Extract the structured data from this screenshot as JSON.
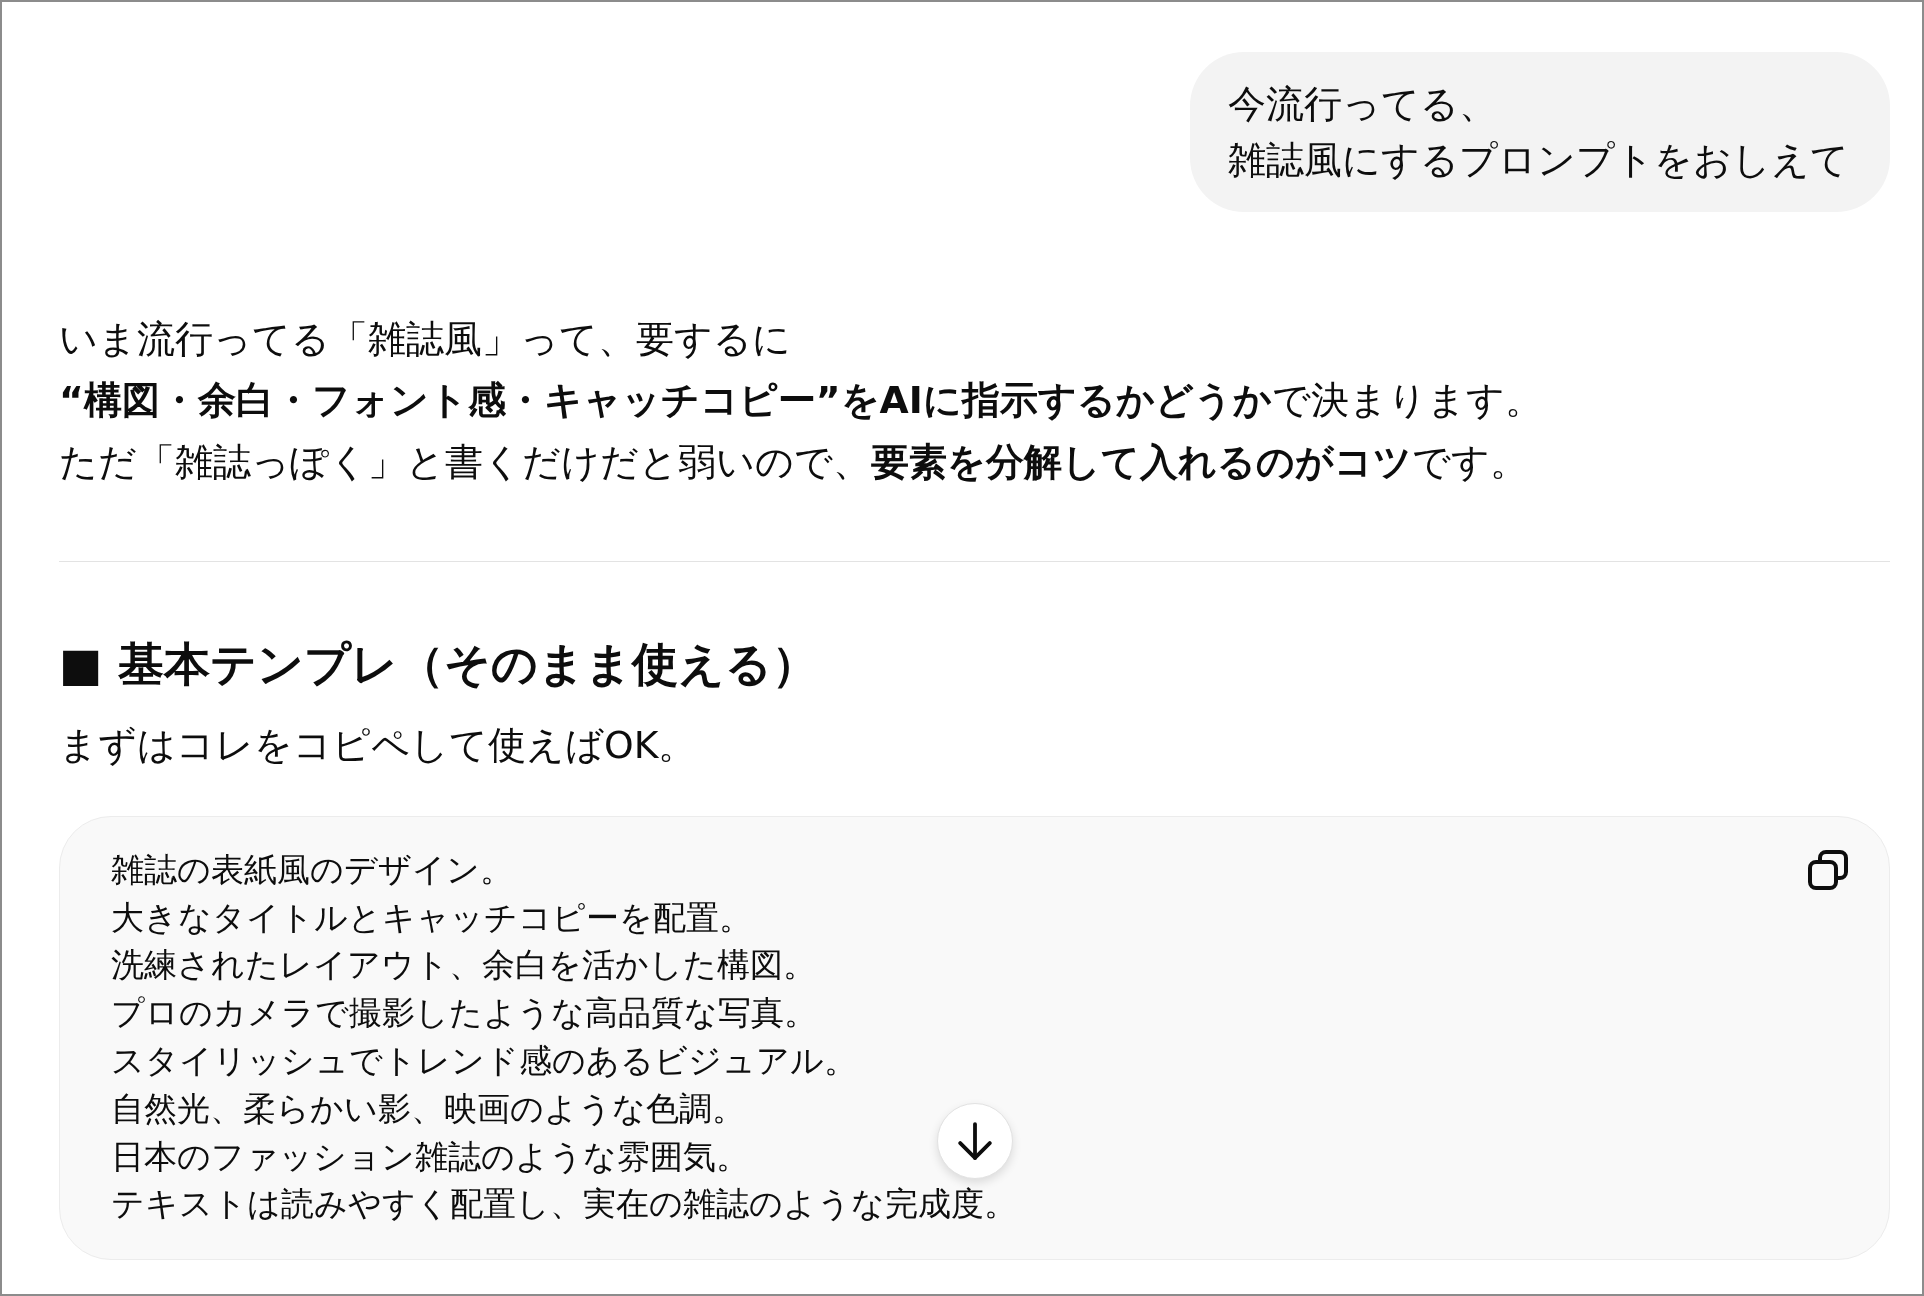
{
  "user_message": {
    "lines": [
      "今流行ってる、",
      "雑誌風にするプロンプトをおしえて"
    ]
  },
  "answer": {
    "intro": [
      "いま流行ってる「雑誌風」って、要するに",
      "**“構図・余白・フォント感・キャッチコピー”をAIに指示するかどうか**で決まります。",
      "ただ「雑誌っぽく」と書くだけだと弱いので、**要素を分解して入れるのがコツ**です。"
    ],
    "section": {
      "heading": "■ 基本テンプレ（そのまま使える）",
      "subtitle": "まずはコレをコピペして使えばOK。",
      "prompt_block": {
        "lines": [
          "雑誌の表紙風のデザイン。",
          "大きなタイトルとキャッチコピーを配置。",
          "洗練されたレイアウト、余白を活かした構図。",
          "プロのカメラで撮影したような高品質な写真。",
          "スタイリッシュでトレンド感のあるビジュアル。",
          "自然光、柔らかい影、映画のような色調。",
          "日本のファッション雑誌のような雰囲気。",
          "テキストは読みやすく配置し、実在の雑誌のような完成度。"
        ]
      }
    }
  }
}
